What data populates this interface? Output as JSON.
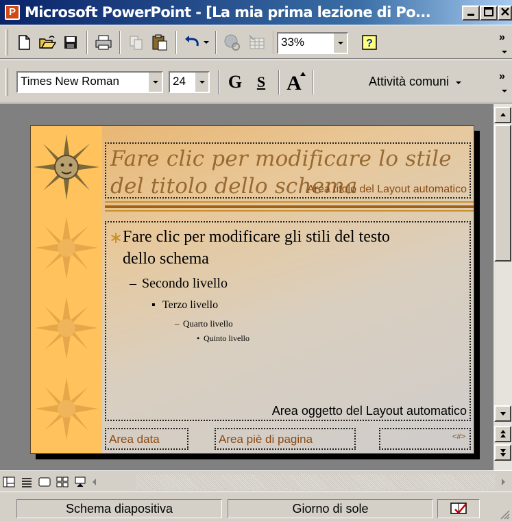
{
  "window": {
    "app_icon_letter": "P",
    "title": "Microsoft PowerPoint - [La mia prima lezione di Po..."
  },
  "toolbar": {
    "zoom": "33%",
    "overflow": "»"
  },
  "formatting": {
    "font_name": "Times New Roman",
    "font_size": "24",
    "bold_label": "G",
    "shadow_label": "S",
    "tasks_label": "Attività comuni",
    "overflow": "»"
  },
  "slide": {
    "title_text": "Fare clic per modificare lo stile\ndel titolo dello schema",
    "title_area_label": "Area titolo del Layout automatico",
    "level1": "Fare clic per modificare gli stili del testo",
    "level1_cont": "dello schema",
    "level2": "Secondo livello",
    "level3": "Terzo livello",
    "level4": "Quarto livello",
    "level5": "Quinto livello",
    "object_area_label": "Area oggetto del Layout automatico",
    "date_area_label": "Area data",
    "footer_area_label": "Area piè di pagina",
    "number_area_label": "<#>"
  },
  "statusbar": {
    "view_name": "Schema diapositiva",
    "design_name": "Giorno di sole"
  },
  "colors": {
    "titlebar_start": "#0a246a",
    "slide_strip": "#ffc25c",
    "title_text": "#8b5a20"
  }
}
